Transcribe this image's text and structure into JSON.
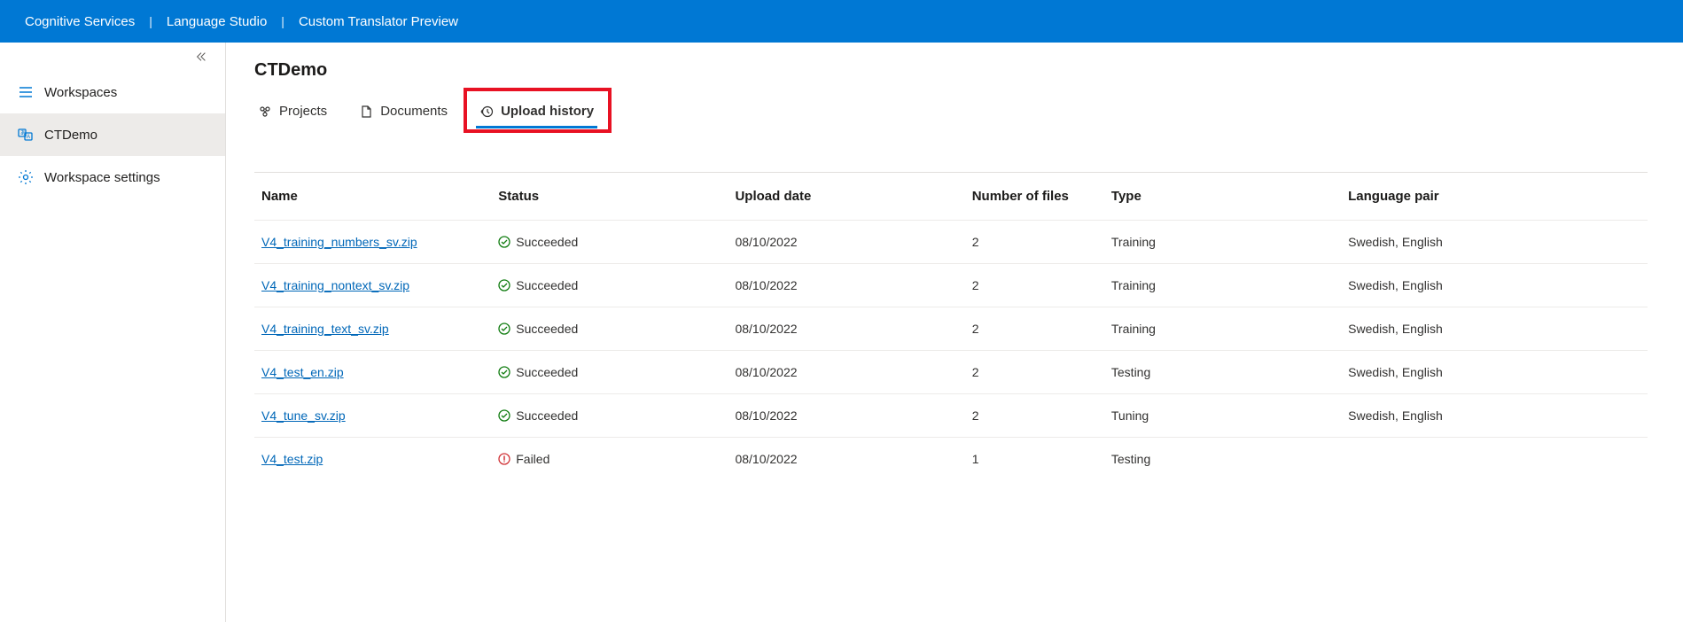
{
  "topbar": {
    "items": [
      "Cognitive Services",
      "Language Studio",
      "Custom Translator Preview"
    ]
  },
  "sidebar": {
    "items": [
      {
        "label": "Workspaces",
        "icon": "list-icon",
        "active": false
      },
      {
        "label": "CTDemo",
        "icon": "translate-icon",
        "active": true
      },
      {
        "label": "Workspace settings",
        "icon": "gear-icon",
        "active": false
      }
    ]
  },
  "page": {
    "title": "CTDemo"
  },
  "tabs": [
    {
      "label": "Projects",
      "icon": "projects-icon",
      "active": false,
      "highlighted": false
    },
    {
      "label": "Documents",
      "icon": "documents-icon",
      "active": false,
      "highlighted": false
    },
    {
      "label": "Upload history",
      "icon": "history-icon",
      "active": true,
      "highlighted": true
    }
  ],
  "table": {
    "headers": [
      "Name",
      "Status",
      "Upload date",
      "Number of files",
      "Type",
      "Language pair"
    ],
    "rows": [
      {
        "name": "V4_training_numbers_sv.zip",
        "status": "Succeeded",
        "status_kind": "success",
        "date": "08/10/2022",
        "files": "2",
        "type": "Training",
        "lang": "Swedish, English"
      },
      {
        "name": "V4_training_nontext_sv.zip",
        "status": "Succeeded",
        "status_kind": "success",
        "date": "08/10/2022",
        "files": "2",
        "type": "Training",
        "lang": "Swedish, English"
      },
      {
        "name": "V4_training_text_sv.zip",
        "status": "Succeeded",
        "status_kind": "success",
        "date": "08/10/2022",
        "files": "2",
        "type": "Training",
        "lang": "Swedish, English"
      },
      {
        "name": "V4_test_en.zip",
        "status": "Succeeded",
        "status_kind": "success",
        "date": "08/10/2022",
        "files": "2",
        "type": "Testing",
        "lang": "Swedish, English"
      },
      {
        "name": "V4_tune_sv.zip",
        "status": "Succeeded",
        "status_kind": "success",
        "date": "08/10/2022",
        "files": "2",
        "type": "Tuning",
        "lang": "Swedish, English"
      },
      {
        "name": "V4_test.zip",
        "status": "Failed",
        "status_kind": "error",
        "date": "08/10/2022",
        "files": "1",
        "type": "Testing",
        "lang": ""
      }
    ]
  }
}
